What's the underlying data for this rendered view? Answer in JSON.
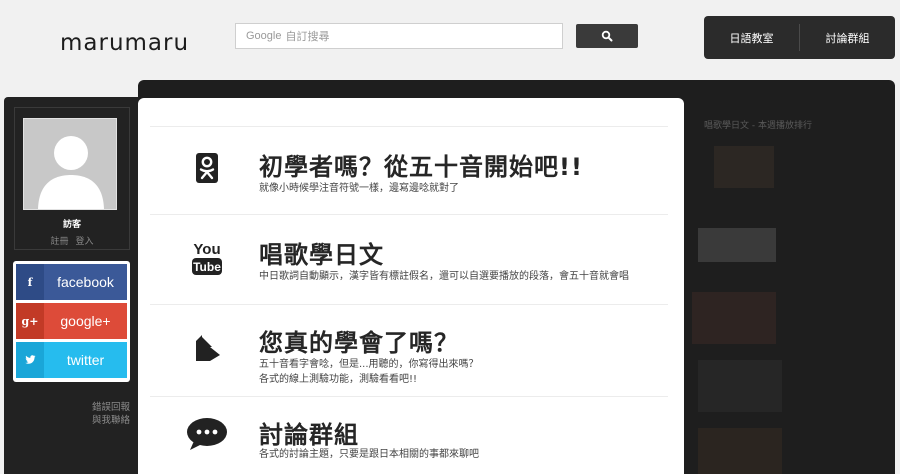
{
  "header": {
    "logo": "marumaru",
    "search_brand": "Google",
    "search_placeholder": "自訂搜尋",
    "nav": [
      "日語教室",
      "討論群組"
    ]
  },
  "sidebar": {
    "user_name": "訪客",
    "register": "註冊",
    "login": "登入",
    "social": [
      {
        "icon": "f",
        "label": "facebook"
      },
      {
        "icon": "g+",
        "label": "google+"
      },
      {
        "icon": "twitter-bird",
        "label": "twitter"
      }
    ],
    "feedback": [
      "錯誤回報",
      "與我聯絡"
    ]
  },
  "features": [
    {
      "icon": "odnoklassniki-icon",
      "title": "初學者嗎？從五十音開始吧!!",
      "desc": "就像小時候學注音符號一樣，邊寫邊唸就對了"
    },
    {
      "icon": "youtube-icon",
      "title": "唱歌學日文",
      "desc": "中日歌詞自動顯示，漢字皆有標註假名，還可以自選要播放的段落，會五十音就會唱"
    },
    {
      "icon": "quiz-icon",
      "title": "您真的學會了嗎？",
      "desc": "五十音看字會唸，但是...用聽的，你寫得出來嗎？\n各式的線上測驗功能，測驗看看吧!!"
    },
    {
      "icon": "chat-bubble-icon",
      "title": "討論群組",
      "desc": "各式的討論主題，只要是跟日本相關的事都來聊吧"
    }
  ],
  "right": {
    "title": "唱歌學日文 - 本週播放排行"
  }
}
